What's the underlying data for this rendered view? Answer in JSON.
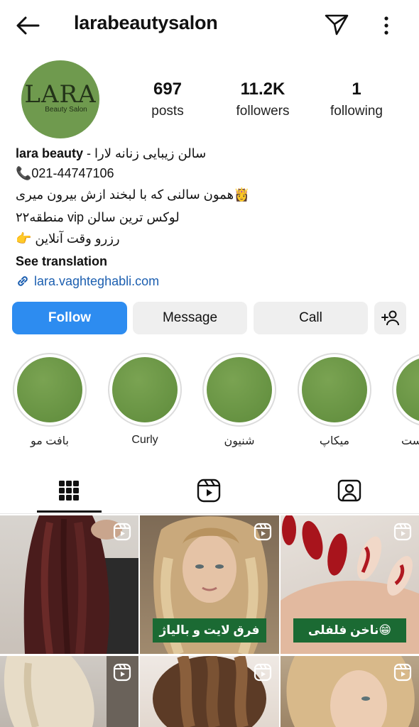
{
  "header": {
    "username": "larabeautysalon",
    "back_icon": "arrow-left-icon",
    "send_icon": "paper-plane-icon",
    "more_icon": "more-vertical-icon"
  },
  "profile": {
    "avatar_logo": "LARA",
    "avatar_subtitle": "Beauty Salon",
    "stats": [
      {
        "value": "697",
        "label": "posts"
      },
      {
        "value": "11.2K",
        "label": "followers"
      },
      {
        "value": "1",
        "label": "following"
      }
    ]
  },
  "bio": {
    "name_line_bold": "lara beauty",
    "name_line_rest": " - سالن زیبایی زنانه لارا",
    "phone": "📞021-44747106",
    "line3": "همون سالنی که با لبخند ازش بیرون میری👸",
    "line4": "۲۲منطقه vip لوکس ترین سالن",
    "line5": "👉 رزرو وقت آنلاین",
    "see_translation": "See translation",
    "link": "lara.vaghteghabli.com"
  },
  "actions": {
    "follow": "Follow",
    "message": "Message",
    "call": "Call",
    "add_user_icon": "add-person-icon"
  },
  "highlights": [
    {
      "label": "بافت مو"
    },
    {
      "label": "Curly"
    },
    {
      "label": "شنیون"
    },
    {
      "label": "میکاپ"
    },
    {
      "label": "ست"
    }
  ],
  "tabs": [
    {
      "icon": "grid-icon",
      "active": true
    },
    {
      "icon": "reels-icon",
      "active": false
    },
    {
      "icon": "tagged-icon",
      "active": false
    }
  ],
  "posts": [
    {
      "overlay": "",
      "reel": true,
      "scene": "dark-long-hair"
    },
    {
      "overlay": "فرق لایت و بالیاژ",
      "reel": true,
      "scene": "blonde-balayage"
    },
    {
      "overlay": "ناخن فلفلی😁",
      "reel": true,
      "scene": "red-nails"
    },
    {
      "overlay": "",
      "reel": true,
      "scene": "blonde-layers"
    },
    {
      "overlay": "",
      "reel": true,
      "scene": "braids"
    },
    {
      "overlay": "",
      "reel": true,
      "scene": "blonde-portrait"
    }
  ],
  "colors": {
    "follow_blue": "#2d8cf0",
    "link_blue": "#1c5fb0",
    "highlight_green": "#6f9a4e",
    "overlay_green": "#1b6a33"
  }
}
